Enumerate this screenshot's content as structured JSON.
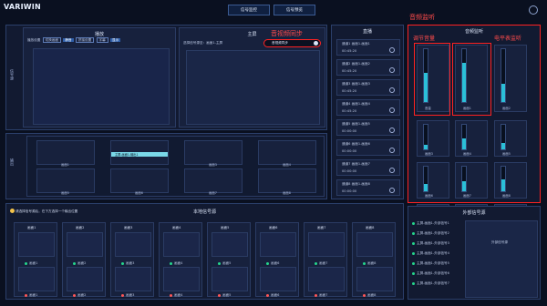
{
  "app": {
    "logo": "VARIWIN",
    "top_buttons": [
      "信号监控",
      "信号预览"
    ]
  },
  "annotations": {
    "audio_sync": "音视频同步",
    "audio_monitor": "音频监听",
    "volume_adjust": "调节音量",
    "level_meter": "电平表监听"
  },
  "left_panel": {
    "label": "信号源",
    "preview_header": "播放",
    "controls": [
      "播放设置",
      "切换画面",
      "静音",
      "拼接设置",
      "字幕",
      "显示"
    ],
    "output_header": "主屏",
    "output_subheader": "选择信号源至：",
    "output_target": "画面1-主屏",
    "sync_button": "音视频同步"
  },
  "middle_panel": {
    "label": "输出",
    "slots": [
      {
        "label": "画面1"
      },
      {
        "label": "主屏-画面1-输出1",
        "highlight": true
      },
      {
        "label": "画面3"
      },
      {
        "label": "画面4"
      },
      {
        "label": "画面5"
      },
      {
        "label": "画面6"
      },
      {
        "label": "画面7"
      },
      {
        "label": "画面8"
      }
    ]
  },
  "schedule": {
    "header": "直播",
    "items": [
      {
        "name": "通道1",
        "tag": "画面1-画面1",
        "time": "00:45:20"
      },
      {
        "name": "通道2",
        "tag": "画面1-画面2",
        "time": "00:45:20"
      },
      {
        "name": "通道3",
        "tag": "画面1-画面3",
        "time": "00:45:20"
      },
      {
        "name": "通道4",
        "tag": "画面1-画面4",
        "time": "00:45:20"
      },
      {
        "name": "通道5",
        "tag": "画面1-画面5",
        "time": "00:00:00"
      },
      {
        "name": "通道6",
        "tag": "画面1-画面6",
        "time": "00:00:00"
      },
      {
        "name": "通道7",
        "tag": "画面1-画面7",
        "time": "00:00:00"
      },
      {
        "name": "通道8",
        "tag": "画面1-画面8",
        "time": "00:00:00"
      }
    ]
  },
  "audio_panel": {
    "header": "音频监听",
    "meters": [
      {
        "label": "音量",
        "level": 0.55
      },
      {
        "label": "画面1",
        "level": 0.75
      },
      {
        "label": "画面2",
        "level": 0.35
      },
      {
        "label": "画面3",
        "level": 0.2
      },
      {
        "label": "画面4",
        "level": 0.45
      },
      {
        "label": "画面5",
        "level": 0.25
      },
      {
        "label": "画面6",
        "level": 0.3
      },
      {
        "label": "画面7",
        "level": 0.4
      },
      {
        "label": "画面8",
        "level": 0.5
      },
      {
        "label": "画面9",
        "level": 0.55
      },
      {
        "label": "画面10",
        "level": 0.35
      },
      {
        "label": "画面11",
        "level": 0.65
      }
    ]
  },
  "source_bar": {
    "notice": "请选择信号源后，在下方选择一个输出位置",
    "title": "本地信号源",
    "sources": [
      {
        "name": "画面1",
        "sub": "画面1"
      },
      {
        "name": "画面2",
        "sub": "画面2"
      },
      {
        "name": "画面3",
        "sub": "画面3"
      },
      {
        "name": "画面4",
        "sub": "画面4"
      },
      {
        "name": "画面5",
        "sub": "画面5"
      },
      {
        "name": "画面6",
        "sub": "画面6"
      },
      {
        "name": "画面7",
        "sub": "画面7"
      },
      {
        "name": "画面8",
        "sub": "画面8"
      }
    ]
  },
  "external_panel": {
    "title": "外部信号源",
    "items": [
      "主屏-画面1-外部信号1",
      "主屏-画面1-外部信号2",
      "主屏-画面1-外部信号3",
      "主屏-画面1-外部信号4",
      "主屏-画面1-外部信号5",
      "主屏-画面1-外部信号6",
      "主屏-画面1-外部信号7"
    ],
    "preview_label": "外部信号源"
  },
  "colors": {
    "accent": "#2bc0d8",
    "red": "#ff2222",
    "dark": "#0a1020"
  }
}
